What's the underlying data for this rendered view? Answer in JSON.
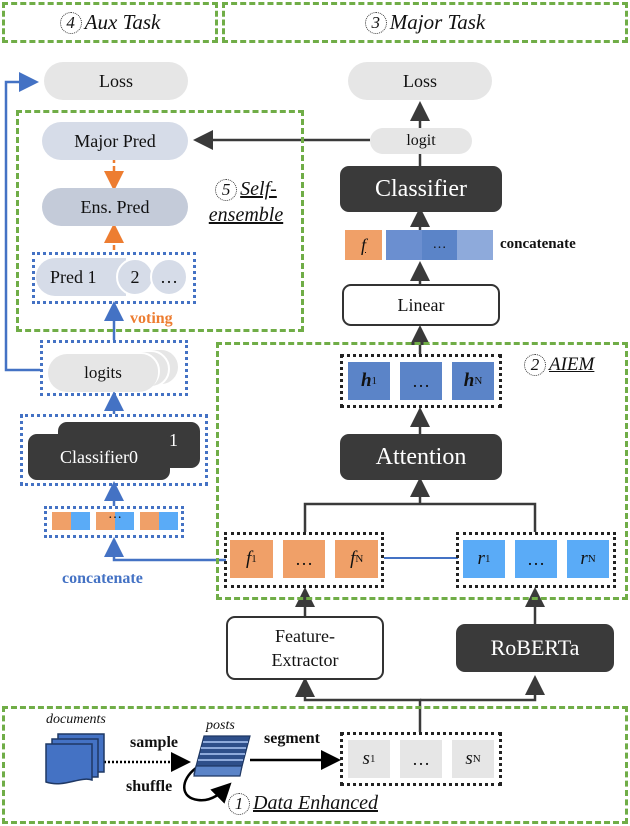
{
  "header": {
    "aux_task": {
      "num": "4",
      "label": "Aux Task"
    },
    "major_task": {
      "num": "3",
      "label": "Major Task"
    }
  },
  "aux": {
    "loss": "Loss",
    "major_pred": "Major Pred",
    "ens_pred": "Ens. Pred",
    "preds": [
      "Pred 1",
      "2",
      "…"
    ],
    "voting": "voting",
    "self_ensemble": {
      "num": "5",
      "line1": "Self-",
      "line2": "ensemble"
    },
    "logits": "logits",
    "classifier0": "Classifier0",
    "classifier_stack_label": "1",
    "concat_cells": [
      "",
      "…",
      ""
    ],
    "concatenate": "concatenate"
  },
  "major": {
    "loss": "Loss",
    "logit": "logit",
    "classifier": "Classifier",
    "f_cell": "f",
    "concat_mid": "…",
    "concatenate": "concatenate",
    "linear": "Linear"
  },
  "aiem": {
    "num": "2",
    "label": "AIEM",
    "h_cells": [
      {
        "main": "h",
        "sub": "1"
      },
      {
        "main": "…",
        "sub": ""
      },
      {
        "main": "h",
        "sub": "N"
      }
    ],
    "attention": "Attention",
    "f_cells": [
      {
        "main": "f",
        "sub": "1"
      },
      {
        "main": "…",
        "sub": ""
      },
      {
        "main": "f",
        "sub": "N"
      }
    ],
    "r_cells": [
      {
        "main": "r",
        "sub": "1"
      },
      {
        "main": "…",
        "sub": ""
      },
      {
        "main": "r",
        "sub": "N"
      }
    ]
  },
  "encoders": {
    "feature_extractor_l1": "Feature-",
    "feature_extractor_l2": "Extractor",
    "roberta": "RoBERTa"
  },
  "data_enhanced": {
    "num": "1",
    "label": "Data Enhanced",
    "documents": "documents",
    "posts": "posts",
    "sample": "sample",
    "shuffle": "shuffle",
    "segment": "segment",
    "s_cells": [
      {
        "main": "s",
        "sub": "1"
      },
      {
        "main": "…",
        "sub": ""
      },
      {
        "main": "s",
        "sub": "N"
      }
    ]
  },
  "colors": {
    "green_dash": "#70ad47",
    "orange": "#f0a068",
    "light_blue": "#5aabf7",
    "mid_blue": "#5b84c8",
    "dark_box": "#3a3a3a",
    "arrow_blue": "#4472c4",
    "arrow_orange": "#ed7d31"
  }
}
